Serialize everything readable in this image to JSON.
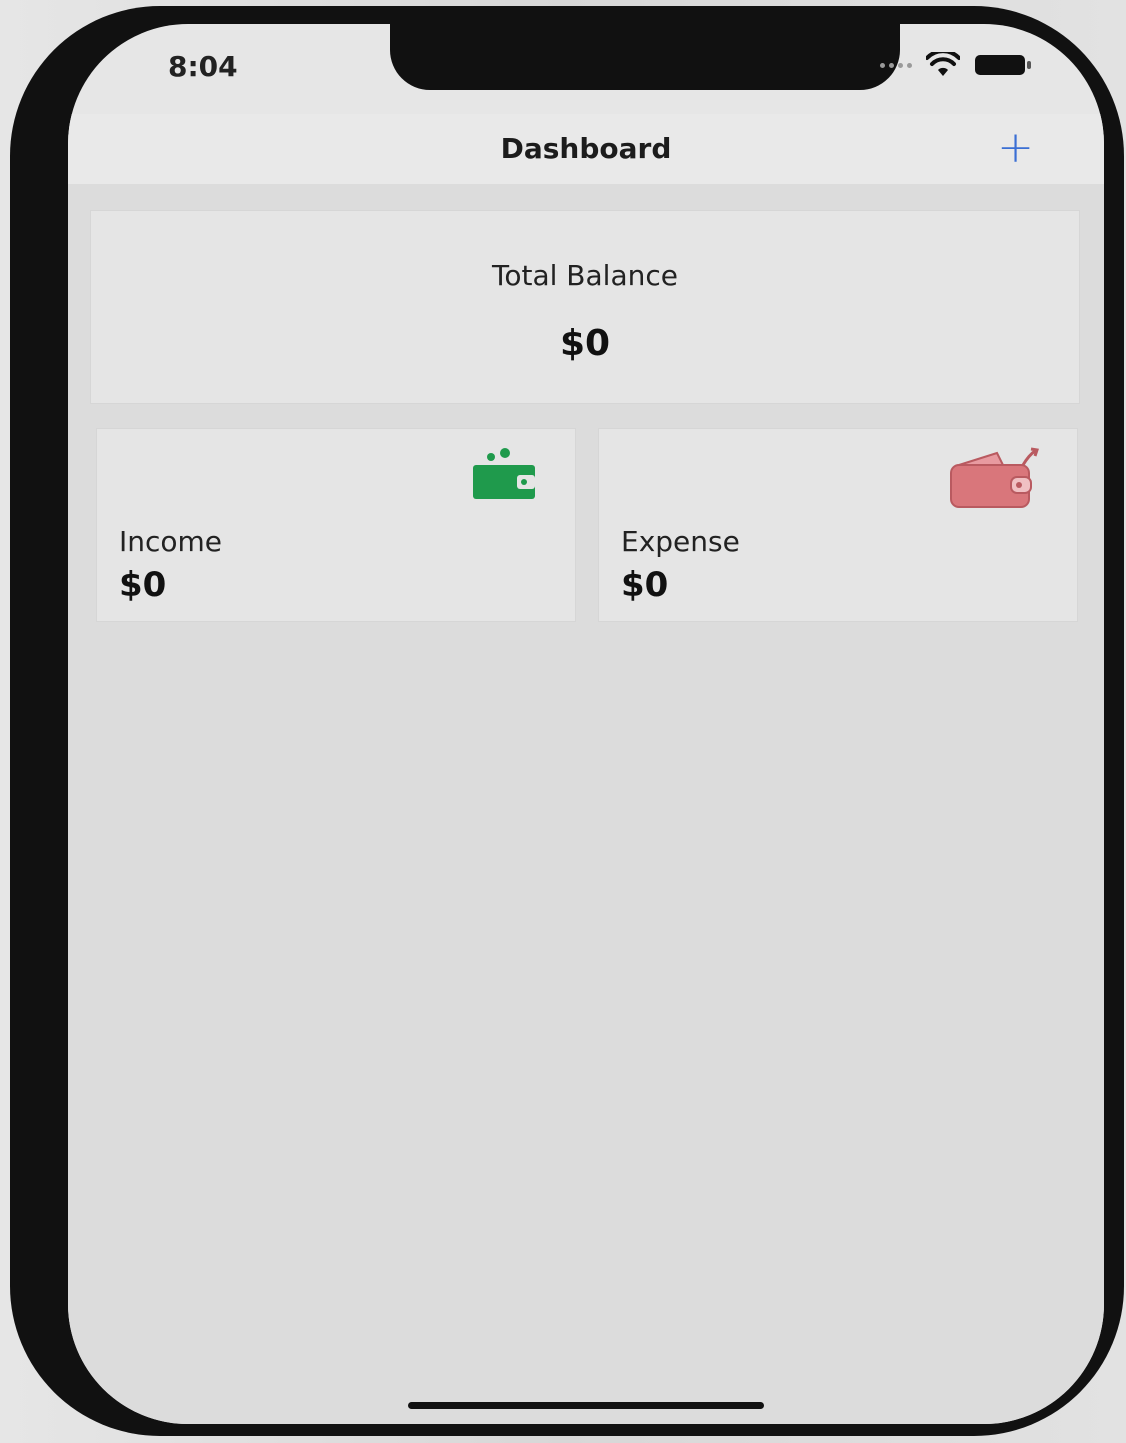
{
  "status_bar": {
    "time": "8:04"
  },
  "nav": {
    "title": "Dashboard",
    "add_label": "+"
  },
  "balance": {
    "label": "Total Balance",
    "value": "$0"
  },
  "income": {
    "label": "Income",
    "value": "$0",
    "icon": "wallet-income-icon",
    "color": "#1f9a4c"
  },
  "expense": {
    "label": "Expense",
    "value": "$0",
    "icon": "wallet-expense-icon",
    "color": "#d9767b"
  }
}
